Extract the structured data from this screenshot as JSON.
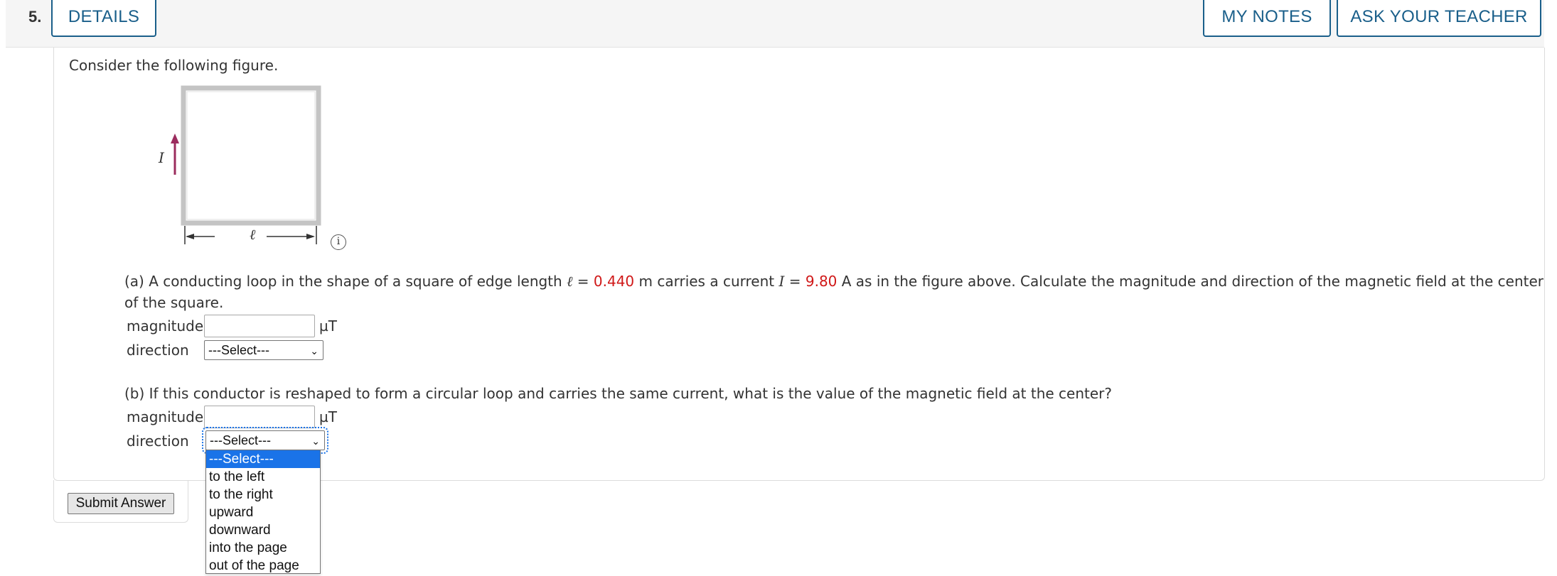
{
  "header": {
    "question_number": "5.",
    "details_label": "DETAILS",
    "my_notes_label": "MY NOTES",
    "ask_teacher_label": "ASK YOUR TEACHER"
  },
  "intro": "Consider the following figure.",
  "figure": {
    "current_label": "I",
    "length_label": "ℓ",
    "info_icon": "info-icon"
  },
  "part_a": {
    "text_1": "(a) A conducting loop in the shape of a square of edge length ",
    "ell": "ℓ",
    "eq_1": " = ",
    "length_value": "0.440",
    "text_2": " m carries a current ",
    "I": "I",
    "eq_2": " = ",
    "current_value": "9.80",
    "text_3": " A as in the figure above. Calculate the magnitude and direction of the magnetic field at the center",
    "text_4": "of the square.",
    "magnitude_label": "magnitude",
    "magnitude_value": "",
    "unit": "µT",
    "direction_label": "direction",
    "direction_value": "---Select---"
  },
  "part_b": {
    "text": "(b) If this conductor is reshaped to form a circular loop and carries the same current, what is the value of the magnetic field at the center?",
    "magnitude_label": "magnitude",
    "magnitude_value": "",
    "unit": "µT",
    "direction_label": "direction",
    "direction_value": "---Select---"
  },
  "dropdown_options": [
    "---Select---",
    "to the left",
    "to the right",
    "upward",
    "downward",
    "into the page",
    "out of the page"
  ],
  "submit_label": "Submit Answer",
  "colors": {
    "accent": "#1a5f8a",
    "given_value": "#d01818",
    "arrow": "#9b2c5e",
    "selected_option": "#1a73e8"
  }
}
